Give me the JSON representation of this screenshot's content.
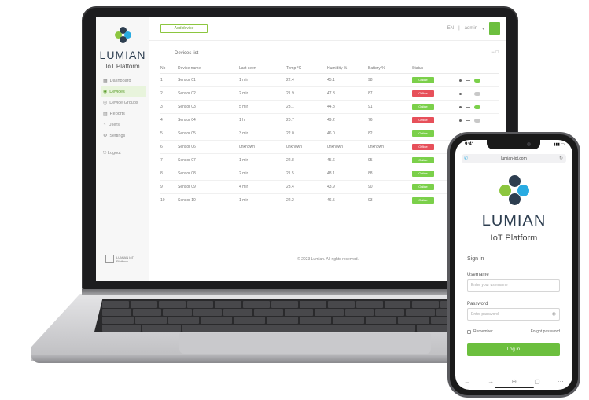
{
  "colors": {
    "brand_green": "#6cbf3e",
    "brand_blue": "#29abe2",
    "brand_dark": "#2d3e50",
    "status_online": "#7bd04a",
    "status_offline": "#e7505a"
  },
  "desktop": {
    "brand": "LUMIAN",
    "brand_sub": "IoT Platform",
    "nav": [
      {
        "label": "Dashboard",
        "icon": "grid-icon"
      },
      {
        "label": "Devices",
        "icon": "device-icon"
      },
      {
        "label": "Device Groups",
        "icon": "group-icon"
      },
      {
        "label": "Reports",
        "icon": "chart-icon"
      },
      {
        "label": "Users",
        "icon": "user-icon"
      },
      {
        "label": "Settings",
        "icon": "gear-icon"
      }
    ],
    "logout_label": "Logout",
    "footer_brand": "LUMIAN IoT Platform",
    "top_button": "Add device",
    "top_right": [
      "EN",
      "|",
      "admin",
      "▾"
    ],
    "section_title": "Devices list",
    "section_tools": "−  □",
    "table_headers": [
      "No",
      "Device name",
      "Last seen",
      "Temp °C",
      "Humidity %",
      "Battery %",
      "Status",
      ""
    ],
    "rows": [
      {
        "no": "1",
        "name": "Sensor 01",
        "last": "1 min",
        "temp": "22.4",
        "hum": "45.1",
        "bat": "98",
        "status": "Online",
        "state": "on"
      },
      {
        "no": "2",
        "name": "Sensor 02",
        "last": "2 min",
        "temp": "21.9",
        "hum": "47.3",
        "bat": "87",
        "status": "Offline",
        "state": "off"
      },
      {
        "no": "3",
        "name": "Sensor 03",
        "last": "5 min",
        "temp": "23.1",
        "hum": "44.8",
        "bat": "91",
        "status": "Online",
        "state": "on"
      },
      {
        "no": "4",
        "name": "Sensor 04",
        "last": "1 h",
        "temp": "20.7",
        "hum": "49.2",
        "bat": "76",
        "status": "Offline",
        "state": "off"
      },
      {
        "no": "5",
        "name": "Sensor 05",
        "last": "3 min",
        "temp": "22.0",
        "hum": "46.0",
        "bat": "82",
        "status": "Online",
        "state": "on"
      },
      {
        "no": "6",
        "name": "Sensor 06",
        "last": "unknown",
        "temp": "unknown",
        "hum": "unknown",
        "bat": "unknown",
        "status": "Offline",
        "state": "off"
      },
      {
        "no": "7",
        "name": "Sensor 07",
        "last": "1 min",
        "temp": "22.8",
        "hum": "45.6",
        "bat": "95",
        "status": "Online",
        "state": "on"
      },
      {
        "no": "8",
        "name": "Sensor 08",
        "last": "2 min",
        "temp": "21.5",
        "hum": "48.1",
        "bat": "88",
        "status": "Online",
        "state": "on"
      },
      {
        "no": "9",
        "name": "Sensor 09",
        "last": "4 min",
        "temp": "23.4",
        "hum": "43.9",
        "bat": "90",
        "status": "Online",
        "state": "on"
      },
      {
        "no": "10",
        "name": "Sensor 10",
        "last": "1 min",
        "temp": "22.2",
        "hum": "46.5",
        "bat": "93",
        "status": "Online",
        "state": "on"
      }
    ],
    "footer_text": "© 2023 Lumian. All rights reserved."
  },
  "phone": {
    "time": "9:41",
    "signal": "▮▮▮ ▭",
    "url": "lumian-iot.com",
    "brand": "LUMIAN",
    "brand_sub": "IoT Platform",
    "sign_in": "Sign in",
    "username_label": "Username",
    "username_placeholder": "Enter your username",
    "password_label": "Password",
    "password_placeholder": "Enter password",
    "remember": "Remember",
    "forgot": "Forgot password",
    "login_button": "Log in",
    "bottom_icons": [
      "←",
      "→",
      "⊕",
      "▢",
      "⋯"
    ]
  }
}
